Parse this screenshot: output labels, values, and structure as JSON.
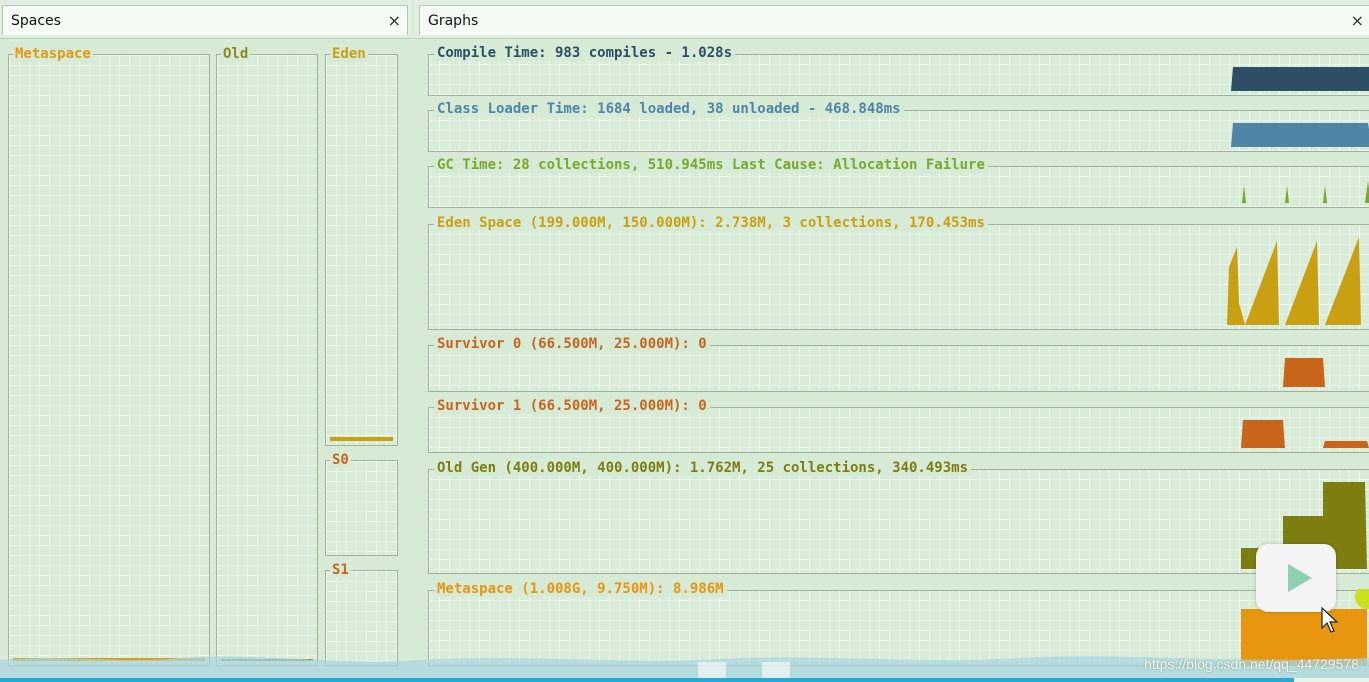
{
  "tabs": {
    "spaces": {
      "label": "Spaces",
      "close": "×"
    },
    "graphs": {
      "label": "Graphs",
      "close": "×"
    }
  },
  "spaces": {
    "metaspace": {
      "label": "Metaspace",
      "color": "#e09a13",
      "fill": 0.01
    },
    "old": {
      "label": "Old",
      "color": "#8a8a20",
      "fill": 0.005
    },
    "eden": {
      "label": "Eden",
      "color": "#c9a011",
      "fill": 0.02
    },
    "s0": {
      "label": "S0",
      "color": "#c9651b",
      "fill": 0.0
    },
    "s1": {
      "label": "S1",
      "color": "#c9651b",
      "fill": 0.0
    }
  },
  "graphs": [
    {
      "key": "compile",
      "title": "Compile Time: 983 compiles - 1.028s",
      "color": "#2c4f66"
    },
    {
      "key": "classloader",
      "title": "Class Loader Time: 1684 loaded, 38 unloaded - 468.848ms",
      "color": "#4f86a8"
    },
    {
      "key": "gc",
      "title": "GC Time: 28 collections, 510.945ms Last Cause: Allocation Failure",
      "color": "#7aa82c"
    },
    {
      "key": "eden",
      "title": "Eden Space (199.000M, 150.000M): 2.738M, 3 collections, 170.453ms",
      "color": "#c9a011"
    },
    {
      "key": "s0",
      "title": "Survivor 0 (66.500M, 25.000M): 0",
      "color": "#c9651b"
    },
    {
      "key": "s1",
      "title": "Survivor 1 (66.500M, 25.000M): 0",
      "color": "#c9651b"
    },
    {
      "key": "old",
      "title": "Old Gen (400.000M, 400.000M): 1.762M, 25 collections, 340.493ms",
      "color": "#7d7d10"
    },
    {
      "key": "metaspace",
      "title": "Metaspace (1.008G, 9.750M): 8.986M",
      "color": "#e8950f"
    }
  ],
  "video": {
    "progress": 0.945
  },
  "watermark": "https://blog.csdn.net/qq_44729578"
}
